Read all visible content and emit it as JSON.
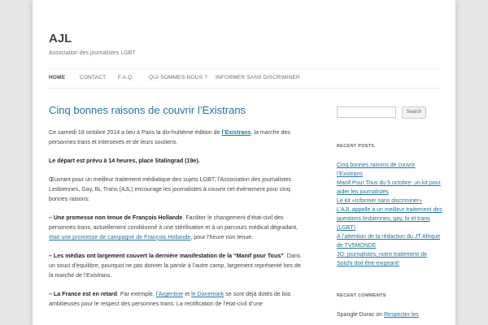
{
  "site": {
    "title": "AJL",
    "description": "Association des journalistes LGBT"
  },
  "nav": {
    "items": [
      {
        "label": "HOME",
        "active": true
      },
      {
        "label": "CONTACT"
      },
      {
        "label": "F.A.Q."
      },
      {
        "label": "QUI SOMMES-NOUS ?"
      },
      {
        "label": "INFORMER SANS DISCRIMINER"
      }
    ]
  },
  "article": {
    "title": "Cinq bonnes raisons de couvrir l’Existrans",
    "p1_before": "Ce samedi 18 octobre 2014 a lieu à Paris la dix-huitième édition de ",
    "p1_link": "l’Existrans",
    "p1_after": ", la marche des personnes trans et intersexes et de leurs soutiens.",
    "p2": "Le départ est prévu à 14 heures, place Stalingrad (19e).",
    "p3": "Œuvrant pour un meilleur traitement médiatique des sujets LGBT, l’Association des journalistes Lesbiennes, Gay, Bi, Trans (AJL) encourage les journalistes à couvrir cet événement pour cinq bonnes raisons:",
    "p4_bold": "– Une promesse non tenue de François Hollande",
    "p4_mid": ". Faciliter le changement d’état-civil des personnes trans, actuellement conditionné à une stérilisation et à un parcours médical dégradant, ",
    "p4_link": "était une promesse de campagne de François Hollande",
    "p4_after": ", pour l’heure non tenue.",
    "p5_bold": "– Les médias ont largement couvert la dernière manifestation de la “Manif pour Tous”",
    "p5_after": ". Dans un souci d’équilibre, pourquoi ne pas donner la parole à l’autre camp, largement représenté lors de la marche de l’Existrans.",
    "p6_bold": "– La France est en retard",
    "p6_mid": ". Par exemple, ",
    "p6_link1": "l’Argentine",
    "p6_and": " et ",
    "p6_link2": "le Danemark",
    "p6_after": " se sont déjà dotés de lois ambitieuses pour le respect des personnes trans. La rectification de l’état-civil d’une"
  },
  "sidebar": {
    "search_placeholder": "",
    "search_button": "Search",
    "recent_posts_title": "RECENT POSTS",
    "recent_posts": [
      "Cinq bonnes raisons de couvrir l’Existrans",
      "Manif Pour Tous du 5 octobre: un kit pour aider les journalistes",
      "Le kit «Informer sans discriminer»",
      "L’AJL appelle à un meilleur traitement des questions lesbiennes, gay, bi et trans (LGBT)",
      "A l’attention de la rédaction du JT Afrique de TV5MONDE",
      "JO: journalistes, notre traitement de Sotchi doit être exigeant!"
    ],
    "recent_comments_title": "RECENT COMMENTS",
    "comment_author": "Spangle Durac",
    "comment_on": " on ",
    "comment_link": "Respecter les"
  }
}
